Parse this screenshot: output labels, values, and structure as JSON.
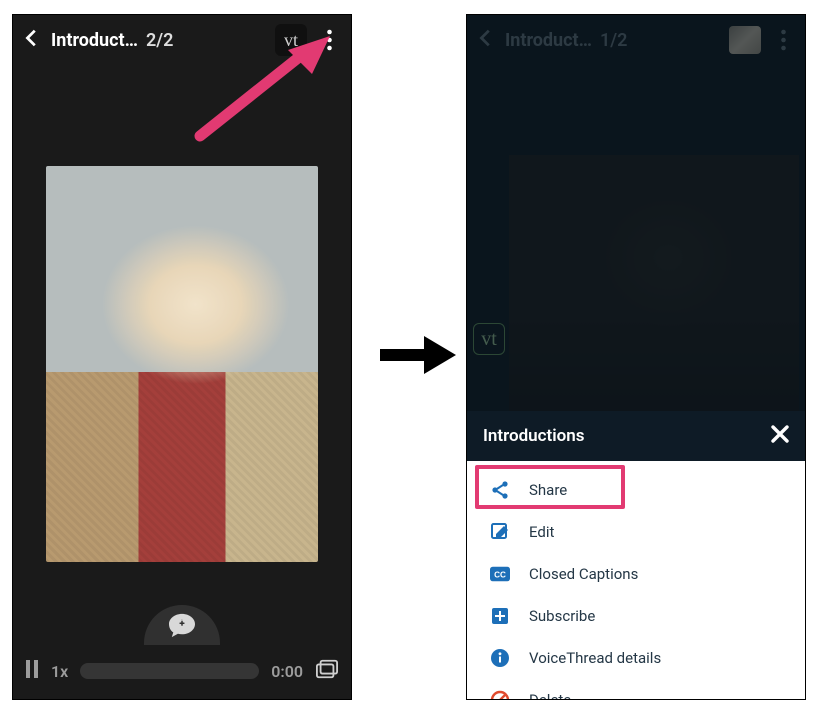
{
  "left": {
    "title": "Introduct…",
    "counter": "2/2",
    "vt_badge": "vt",
    "speed": "1x",
    "time": "0:00"
  },
  "right": {
    "title": "Introduct…",
    "counter": "1/2",
    "vt_badge": "vt",
    "sheet_title": "Introductions",
    "menu": {
      "share": "Share",
      "edit": "Edit",
      "cc": "Closed Captions",
      "subscribe": "Subscribe",
      "details": "VoiceThread details",
      "delete": "Delete"
    }
  },
  "colors": {
    "highlight_pink": "#e23a72"
  }
}
